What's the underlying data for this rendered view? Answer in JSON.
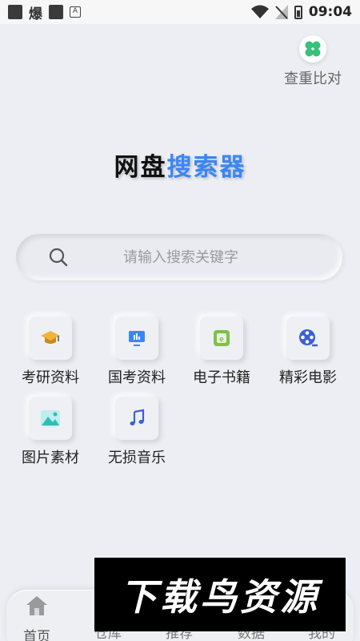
{
  "status_bar": {
    "left_glyph": "爆",
    "time": "09:04"
  },
  "compare": {
    "label": "查重比对",
    "icon": "clover-icon"
  },
  "title": {
    "part1": "网盘",
    "part2": "搜索器"
  },
  "search": {
    "placeholder": "请输入搜索关键字"
  },
  "categories": [
    {
      "label": "考研资料",
      "icon": "graduation-cap-icon"
    },
    {
      "label": "国考资料",
      "icon": "presentation-board-icon"
    },
    {
      "label": "电子书籍",
      "icon": "ebook-icon"
    },
    {
      "label": "精彩电影",
      "icon": "film-reel-icon"
    },
    {
      "label": "图片素材",
      "icon": "image-icon"
    },
    {
      "label": "无损音乐",
      "icon": "music-note-icon"
    }
  ],
  "nav": [
    {
      "label": "首页",
      "icon": "home-icon",
      "active": true
    },
    {
      "label": "仓库",
      "icon": "warehouse-icon"
    },
    {
      "label": "推荐",
      "icon": "recommend-icon"
    },
    {
      "label": "数据",
      "icon": "data-icon"
    },
    {
      "label": "我的",
      "icon": "profile-icon"
    }
  ],
  "watermark": {
    "text": "下载鸟资源"
  },
  "colors": {
    "accent": "#3a86f5",
    "background": "#eceef3"
  }
}
